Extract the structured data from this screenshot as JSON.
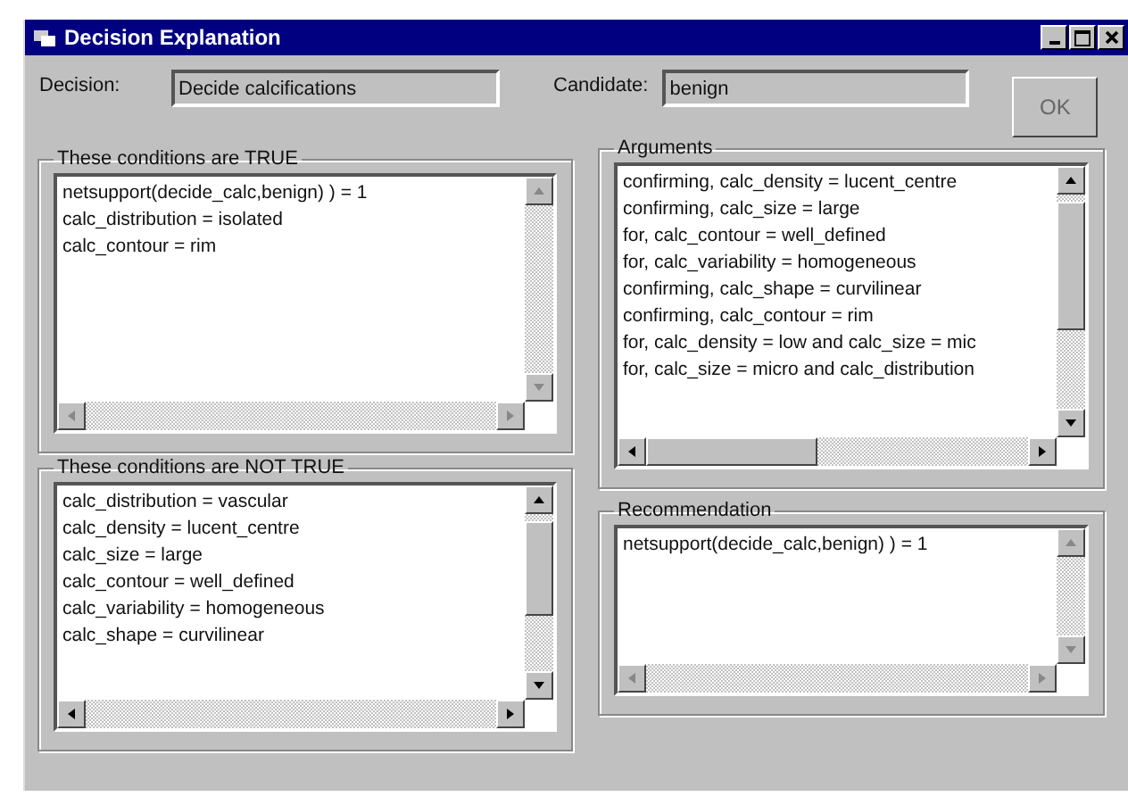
{
  "window": {
    "title": "Decision Explanation"
  },
  "decision": {
    "label": "Decision:",
    "value": "Decide calcifications"
  },
  "candidate": {
    "label": "Candidate:",
    "value": "benign"
  },
  "ok_button": "OK",
  "groups": [
    {
      "title": "These conditions are TRUE",
      "scrollbars_enabled": false,
      "items": [
        "netsupport(decide_calc,benign) ) = 1",
        "calc_distribution = isolated",
        "calc_contour = rim"
      ]
    },
    {
      "title": "Arguments",
      "scrollbars_enabled": true,
      "items": [
        "confirming, calc_density = lucent_centre",
        "confirming, calc_size = large",
        "for, calc_contour = well_defined",
        "for, calc_variability = homogeneous",
        "confirming, calc_shape = curvilinear",
        "confirming, calc_contour = rim",
        "for, calc_density = low and calc_size = mic",
        "for, calc_size = micro and calc_distribution"
      ]
    },
    {
      "title": "These conditions are NOT TRUE",
      "scrollbars_enabled": true,
      "items": [
        "calc_distribution = vascular",
        "calc_density = lucent_centre",
        "calc_size = large",
        "calc_contour = well_defined",
        "calc_variability = homogeneous",
        "calc_shape = curvilinear"
      ]
    },
    {
      "title": "Recommendation",
      "scrollbars_enabled": false,
      "items": [
        "netsupport(decide_calc,benign) ) = 1"
      ]
    }
  ]
}
